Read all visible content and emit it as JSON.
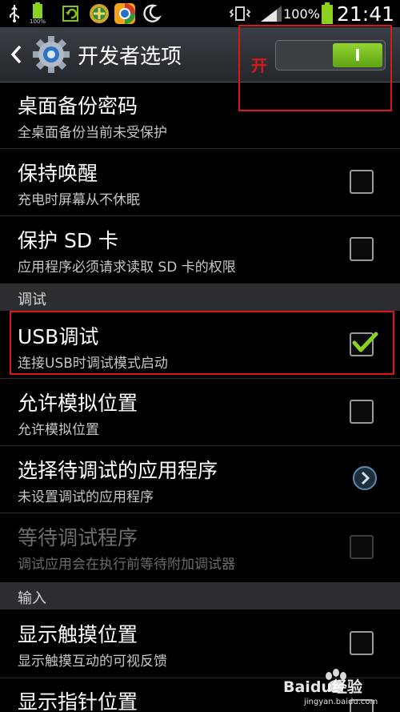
{
  "status_bar": {
    "icons": [
      "usb-icon",
      "battery-100-icon",
      "refresh-icon",
      "game-icon",
      "chrome-icon",
      "moon-icon",
      "vibrate-icon",
      "signal-icon",
      "battery-icon"
    ],
    "small_battery_label": "100%",
    "battery_percent": "100%",
    "time": "21:41"
  },
  "action_bar": {
    "title": "开发者选项",
    "annotation": "开",
    "toggle_state": "on",
    "toggle_label": "I"
  },
  "settings": [
    {
      "kind": "item",
      "title": "桌面备份密码",
      "subtitle": "全桌面备份当前未受保护",
      "control": "none",
      "enabled": true
    },
    {
      "kind": "item",
      "title": "保持唤醒",
      "subtitle": "充电时屏幕从不休眠",
      "control": "checkbox",
      "checked": false,
      "enabled": true
    },
    {
      "kind": "item",
      "title": "保护 SD 卡",
      "subtitle": "应用程序必须请求读取 SD 卡的权限",
      "control": "checkbox",
      "checked": false,
      "enabled": true
    },
    {
      "kind": "section",
      "label": "调试"
    },
    {
      "kind": "item",
      "title": "USB调试",
      "subtitle": "连接USB时调试模式启动",
      "control": "checkbox",
      "checked": true,
      "enabled": true
    },
    {
      "kind": "item",
      "title": "允许模拟位置",
      "subtitle": "允许模拟位置",
      "control": "checkbox",
      "checked": false,
      "enabled": true
    },
    {
      "kind": "item",
      "title": "选择待调试的应用程序",
      "subtitle": "未设置调试的应用程序",
      "control": "chevron",
      "enabled": true
    },
    {
      "kind": "item",
      "title": "等待调试程序",
      "subtitle": "调试应用会在执行前等待附加调试器",
      "control": "checkbox",
      "checked": false,
      "enabled": false
    },
    {
      "kind": "section",
      "label": "输入"
    },
    {
      "kind": "item",
      "title": "显示触摸位置",
      "subtitle": "显示触摸互动的可视反馈",
      "control": "checkbox",
      "checked": false,
      "enabled": true
    },
    {
      "kind": "item",
      "title": "显示指针位置",
      "subtitle": "",
      "control": "checkbox",
      "checked": false,
      "enabled": true
    }
  ],
  "watermark": {
    "text": "Baidu经验",
    "url_text": "jingyan.baidu.com"
  },
  "colors": {
    "toggle_on": "#7ec11f",
    "checkmark": "#8bd11f",
    "annotation_red": "#d9181e",
    "action_bar": "#2e3237",
    "section_header": "#2b2d31"
  }
}
